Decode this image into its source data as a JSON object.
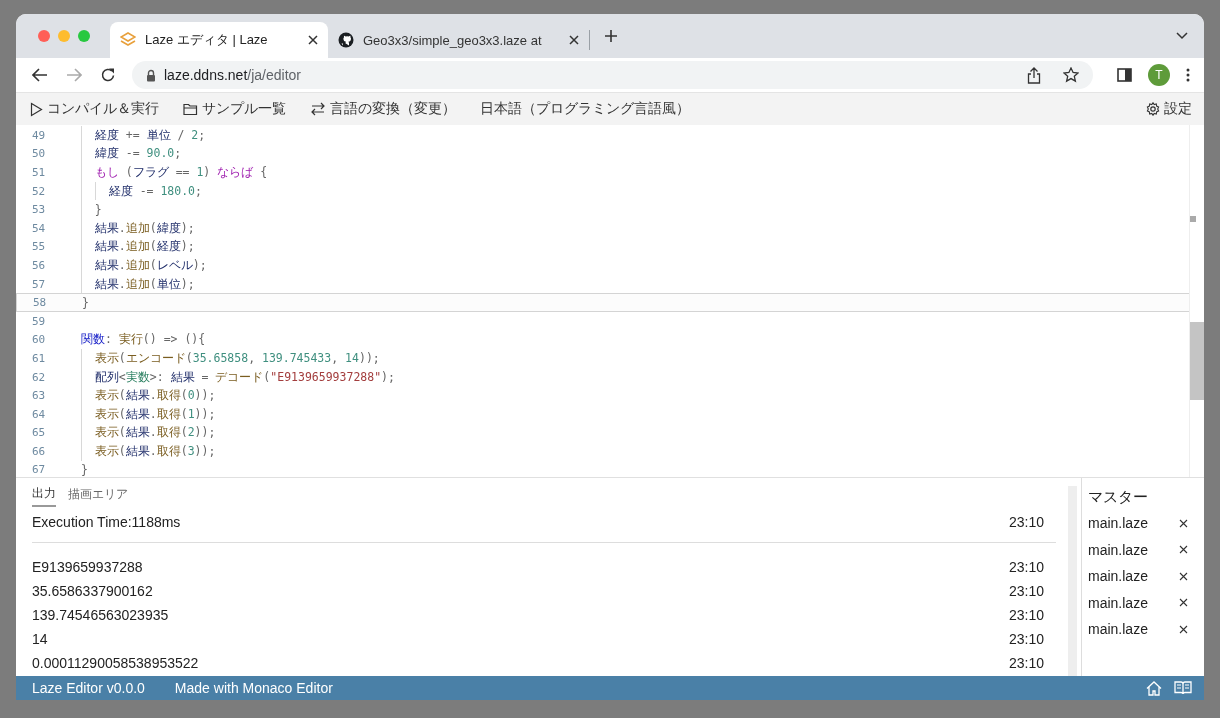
{
  "browser": {
    "tabs": [
      {
        "title": "Laze エディタ | Laze",
        "selected": true
      },
      {
        "title": "Geo3x3/simple_geo3x3.laze at",
        "selected": false
      }
    ],
    "url": {
      "host": "laze.ddns.net",
      "path": "/ja/editor"
    },
    "avatar": "T"
  },
  "menu": {
    "items": [
      {
        "kind": "run",
        "label": "コンパイル＆実行"
      },
      {
        "kind": "folder",
        "label": "サンプル一覧"
      },
      {
        "kind": "convert",
        "label": "言語の変換（変更）"
      },
      {
        "kind": "plain",
        "label": "日本語（プログラミング言語風）"
      }
    ],
    "settings": "設定"
  },
  "editor": {
    "lines": [
      {
        "number": "49",
        "current": false,
        "tokens": [
          {
            "kind": "id",
            "t": "  経度"
          },
          {
            "kind": "op",
            "t": " += "
          },
          {
            "kind": "id",
            "t": "単位"
          },
          {
            "kind": "op",
            "t": " / "
          },
          {
            "kind": "num",
            "t": "2"
          },
          {
            "kind": "op",
            "t": ";"
          }
        ]
      },
      {
        "number": "50",
        "current": false,
        "tokens": [
          {
            "kind": "id",
            "t": "  緯度"
          },
          {
            "kind": "op",
            "t": " -= "
          },
          {
            "kind": "num",
            "t": "90.0"
          },
          {
            "kind": "op",
            "t": ";"
          }
        ]
      },
      {
        "number": "51",
        "current": false,
        "tokens": [
          {
            "kind": "ctl",
            "t": "  もし"
          },
          {
            "kind": "op",
            "t": " ("
          },
          {
            "kind": "id",
            "t": "フラグ"
          },
          {
            "kind": "op",
            "t": " == "
          },
          {
            "kind": "num",
            "t": "1"
          },
          {
            "kind": "op",
            "t": ") "
          },
          {
            "kind": "ctl",
            "t": "ならば"
          },
          {
            "kind": "op",
            "t": " {"
          }
        ]
      },
      {
        "number": "52",
        "current": false,
        "tokens": [
          {
            "kind": "id",
            "t": "    経度"
          },
          {
            "kind": "op",
            "t": " -= "
          },
          {
            "kind": "num",
            "t": "180.0"
          },
          {
            "kind": "op",
            "t": ";"
          }
        ]
      },
      {
        "number": "53",
        "current": false,
        "tokens": [
          {
            "kind": "op",
            "t": "  }"
          }
        ]
      },
      {
        "number": "54",
        "current": false,
        "tokens": [
          {
            "kind": "id",
            "t": "  結果"
          },
          {
            "kind": "op",
            "t": "."
          },
          {
            "kind": "fn",
            "t": "追加"
          },
          {
            "kind": "op",
            "t": "("
          },
          {
            "kind": "id",
            "t": "緯度"
          },
          {
            "kind": "op",
            "t": ");"
          }
        ]
      },
      {
        "number": "55",
        "current": false,
        "tokens": [
          {
            "kind": "id",
            "t": "  結果"
          },
          {
            "kind": "op",
            "t": "."
          },
          {
            "kind": "fn",
            "t": "追加"
          },
          {
            "kind": "op",
            "t": "("
          },
          {
            "kind": "id",
            "t": "経度"
          },
          {
            "kind": "op",
            "t": ");"
          }
        ]
      },
      {
        "number": "56",
        "current": false,
        "tokens": [
          {
            "kind": "id",
            "t": "  結果"
          },
          {
            "kind": "op",
            "t": "."
          },
          {
            "kind": "fn",
            "t": "追加"
          },
          {
            "kind": "op",
            "t": "("
          },
          {
            "kind": "id",
            "t": "レベル"
          },
          {
            "kind": "op",
            "t": ");"
          }
        ]
      },
      {
        "number": "57",
        "current": false,
        "tokens": [
          {
            "kind": "id",
            "t": "  結果"
          },
          {
            "kind": "op",
            "t": "."
          },
          {
            "kind": "fn",
            "t": "追加"
          },
          {
            "kind": "op",
            "t": "("
          },
          {
            "kind": "id",
            "t": "単位"
          },
          {
            "kind": "op",
            "t": ");"
          }
        ]
      },
      {
        "number": "58",
        "current": true,
        "tokens": [
          {
            "kind": "op",
            "t": "}"
          }
        ]
      },
      {
        "number": "59",
        "current": false
      },
      {
        "number": "60",
        "current": false,
        "tokens": [
          {
            "kind": "kw",
            "t": "関数"
          },
          {
            "kind": "op",
            "t": ": "
          },
          {
            "kind": "fn",
            "t": "実行"
          },
          {
            "kind": "op",
            "t": "() => (){"
          }
        ]
      },
      {
        "number": "61",
        "current": false,
        "tokens": [
          {
            "kind": "fn",
            "t": "  表示"
          },
          {
            "kind": "op",
            "t": "("
          },
          {
            "kind": "fn",
            "t": "エンコード"
          },
          {
            "kind": "op",
            "t": "("
          },
          {
            "kind": "num",
            "t": "35.65858"
          },
          {
            "kind": "op",
            "t": ", "
          },
          {
            "kind": "num",
            "t": "139.745433"
          },
          {
            "kind": "op",
            "t": ", "
          },
          {
            "kind": "num",
            "t": "14"
          },
          {
            "kind": "op",
            "t": "));"
          }
        ]
      },
      {
        "number": "62",
        "current": false,
        "tokens": [
          {
            "kind": "id",
            "t": "  配列"
          },
          {
            "kind": "op",
            "t": "<"
          },
          {
            "kind": "type",
            "t": "実数"
          },
          {
            "kind": "op",
            "t": ">: "
          },
          {
            "kind": "id",
            "t": "結果"
          },
          {
            "kind": "op",
            "t": " = "
          },
          {
            "kind": "fn",
            "t": "デコード"
          },
          {
            "kind": "op",
            "t": "("
          },
          {
            "kind": "str",
            "t": "\"E9139659937288\""
          },
          {
            "kind": "op",
            "t": ");"
          }
        ]
      },
      {
        "number": "63",
        "current": false,
        "tokens": [
          {
            "kind": "fn",
            "t": "  表示"
          },
          {
            "kind": "op",
            "t": "("
          },
          {
            "kind": "id",
            "t": "結果"
          },
          {
            "kind": "op",
            "t": "."
          },
          {
            "kind": "fn",
            "t": "取得"
          },
          {
            "kind": "op",
            "t": "("
          },
          {
            "kind": "num",
            "t": "0"
          },
          {
            "kind": "op",
            "t": "));"
          }
        ]
      },
      {
        "number": "64",
        "current": false,
        "tokens": [
          {
            "kind": "fn",
            "t": "  表示"
          },
          {
            "kind": "op",
            "t": "("
          },
          {
            "kind": "id",
            "t": "結果"
          },
          {
            "kind": "op",
            "t": "."
          },
          {
            "kind": "fn",
            "t": "取得"
          },
          {
            "kind": "op",
            "t": "("
          },
          {
            "kind": "num",
            "t": "1"
          },
          {
            "kind": "op",
            "t": "));"
          }
        ]
      },
      {
        "number": "65",
        "current": false,
        "tokens": [
          {
            "kind": "fn",
            "t": "  表示"
          },
          {
            "kind": "op",
            "t": "("
          },
          {
            "kind": "id",
            "t": "結果"
          },
          {
            "kind": "op",
            "t": "."
          },
          {
            "kind": "fn",
            "t": "取得"
          },
          {
            "kind": "op",
            "t": "("
          },
          {
            "kind": "num",
            "t": "2"
          },
          {
            "kind": "op",
            "t": "));"
          }
        ]
      },
      {
        "number": "66",
        "current": false,
        "tokens": [
          {
            "kind": "fn",
            "t": "  表示"
          },
          {
            "kind": "op",
            "t": "("
          },
          {
            "kind": "id",
            "t": "結果"
          },
          {
            "kind": "op",
            "t": "."
          },
          {
            "kind": "fn",
            "t": "取得"
          },
          {
            "kind": "op",
            "t": "("
          },
          {
            "kind": "num",
            "t": "3"
          },
          {
            "kind": "op",
            "t": "));"
          }
        ]
      },
      {
        "number": "67",
        "current": false,
        "tokens": [
          {
            "kind": "op",
            "t": "}"
          }
        ]
      }
    ]
  },
  "output": {
    "tabs": [
      {
        "label": "出力",
        "selected": true
      },
      {
        "label": "描画エリア",
        "selected": false
      }
    ],
    "rows": [
      {
        "kind": "summary",
        "text": "Execution Time:1188ms",
        "time": "23:10"
      },
      {
        "kind": "result",
        "text": "E9139659937288",
        "time": "23:10"
      },
      {
        "kind": "result",
        "text": "35.6586337900162",
        "time": "23:10"
      },
      {
        "kind": "result",
        "text": "139.74546563023935",
        "time": "23:10"
      },
      {
        "kind": "result",
        "text": "14",
        "time": "23:10"
      },
      {
        "kind": "result",
        "text": "0.00011290058538953522",
        "time": "23:10"
      }
    ]
  },
  "files": {
    "header": "マスター",
    "items": [
      {
        "name": "main.laze"
      },
      {
        "name": "main.laze"
      },
      {
        "name": "main.laze"
      },
      {
        "name": "main.laze"
      },
      {
        "name": "main.laze"
      }
    ]
  },
  "status_bar": {
    "items": [
      "Laze Editor v0.0.0",
      "Made with Monaco Editor"
    ]
  }
}
